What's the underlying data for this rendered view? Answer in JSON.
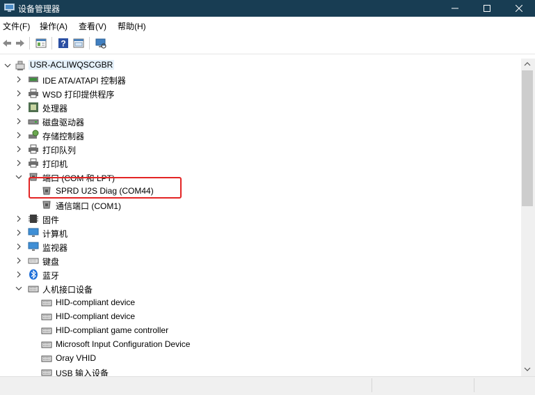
{
  "window": {
    "title": "设备管理器",
    "controls": {
      "minimize": "minimize-icon",
      "maximize": "maximize-icon",
      "close": "close-icon"
    }
  },
  "menu": {
    "items": [
      {
        "label": "文件(F)"
      },
      {
        "label": "操作(A)"
      },
      {
        "label": "查看(V)"
      },
      {
        "label": "帮助(H)"
      }
    ]
  },
  "toolbar": {
    "icons": [
      "back-arrow-icon",
      "forward-arrow-icon",
      "properties-icon",
      "help-icon",
      "view-pane-icon",
      "monitor-scan-icon"
    ]
  },
  "tree": {
    "root": {
      "label": "USR-ACLIWQSCGBR",
      "icon": "computer-tower-icon"
    },
    "categories": [
      {
        "label": "IDE ATA/ATAPI 控制器",
        "icon": "ide-controller-icon"
      },
      {
        "label": "WSD 打印提供程序",
        "icon": "printer-icon"
      },
      {
        "label": "处理器",
        "icon": "cpu-icon"
      },
      {
        "label": "磁盘驱动器",
        "icon": "disk-drive-icon"
      },
      {
        "label": "存储控制器",
        "icon": "storage-controller-icon"
      },
      {
        "label": "打印队列",
        "icon": "printer-icon"
      },
      {
        "label": "打印机",
        "icon": "printer-icon"
      },
      {
        "label": "端口 (COM 和 LPT)",
        "icon": "port-icon",
        "children": [
          {
            "label": "SPRD U2S Diag (COM44)",
            "icon": "port-icon"
          },
          {
            "label": "通信端口 (COM1)",
            "icon": "port-icon"
          }
        ]
      },
      {
        "label": "固件",
        "icon": "firmware-chip-icon"
      },
      {
        "label": "计算机",
        "icon": "monitor-icon"
      },
      {
        "label": "监视器",
        "icon": "monitor-icon"
      },
      {
        "label": "键盘",
        "icon": "keyboard-icon"
      },
      {
        "label": "蓝牙",
        "icon": "bluetooth-icon"
      },
      {
        "label": "人机接口设备",
        "icon": "hid-icon",
        "children": [
          {
            "label": "HID-compliant device",
            "icon": "hid-icon"
          },
          {
            "label": "HID-compliant device",
            "icon": "hid-icon"
          },
          {
            "label": "HID-compliant game controller",
            "icon": "hid-icon"
          },
          {
            "label": "Microsoft Input Configuration Device",
            "icon": "hid-icon"
          },
          {
            "label": "Oray VHID",
            "icon": "hid-icon"
          },
          {
            "label": "USB 输入设备",
            "icon": "hid-icon"
          }
        ]
      }
    ]
  },
  "colors": {
    "titlebar": "#183d53",
    "highlight": "#e32424",
    "selection": "#e5f1fb"
  }
}
